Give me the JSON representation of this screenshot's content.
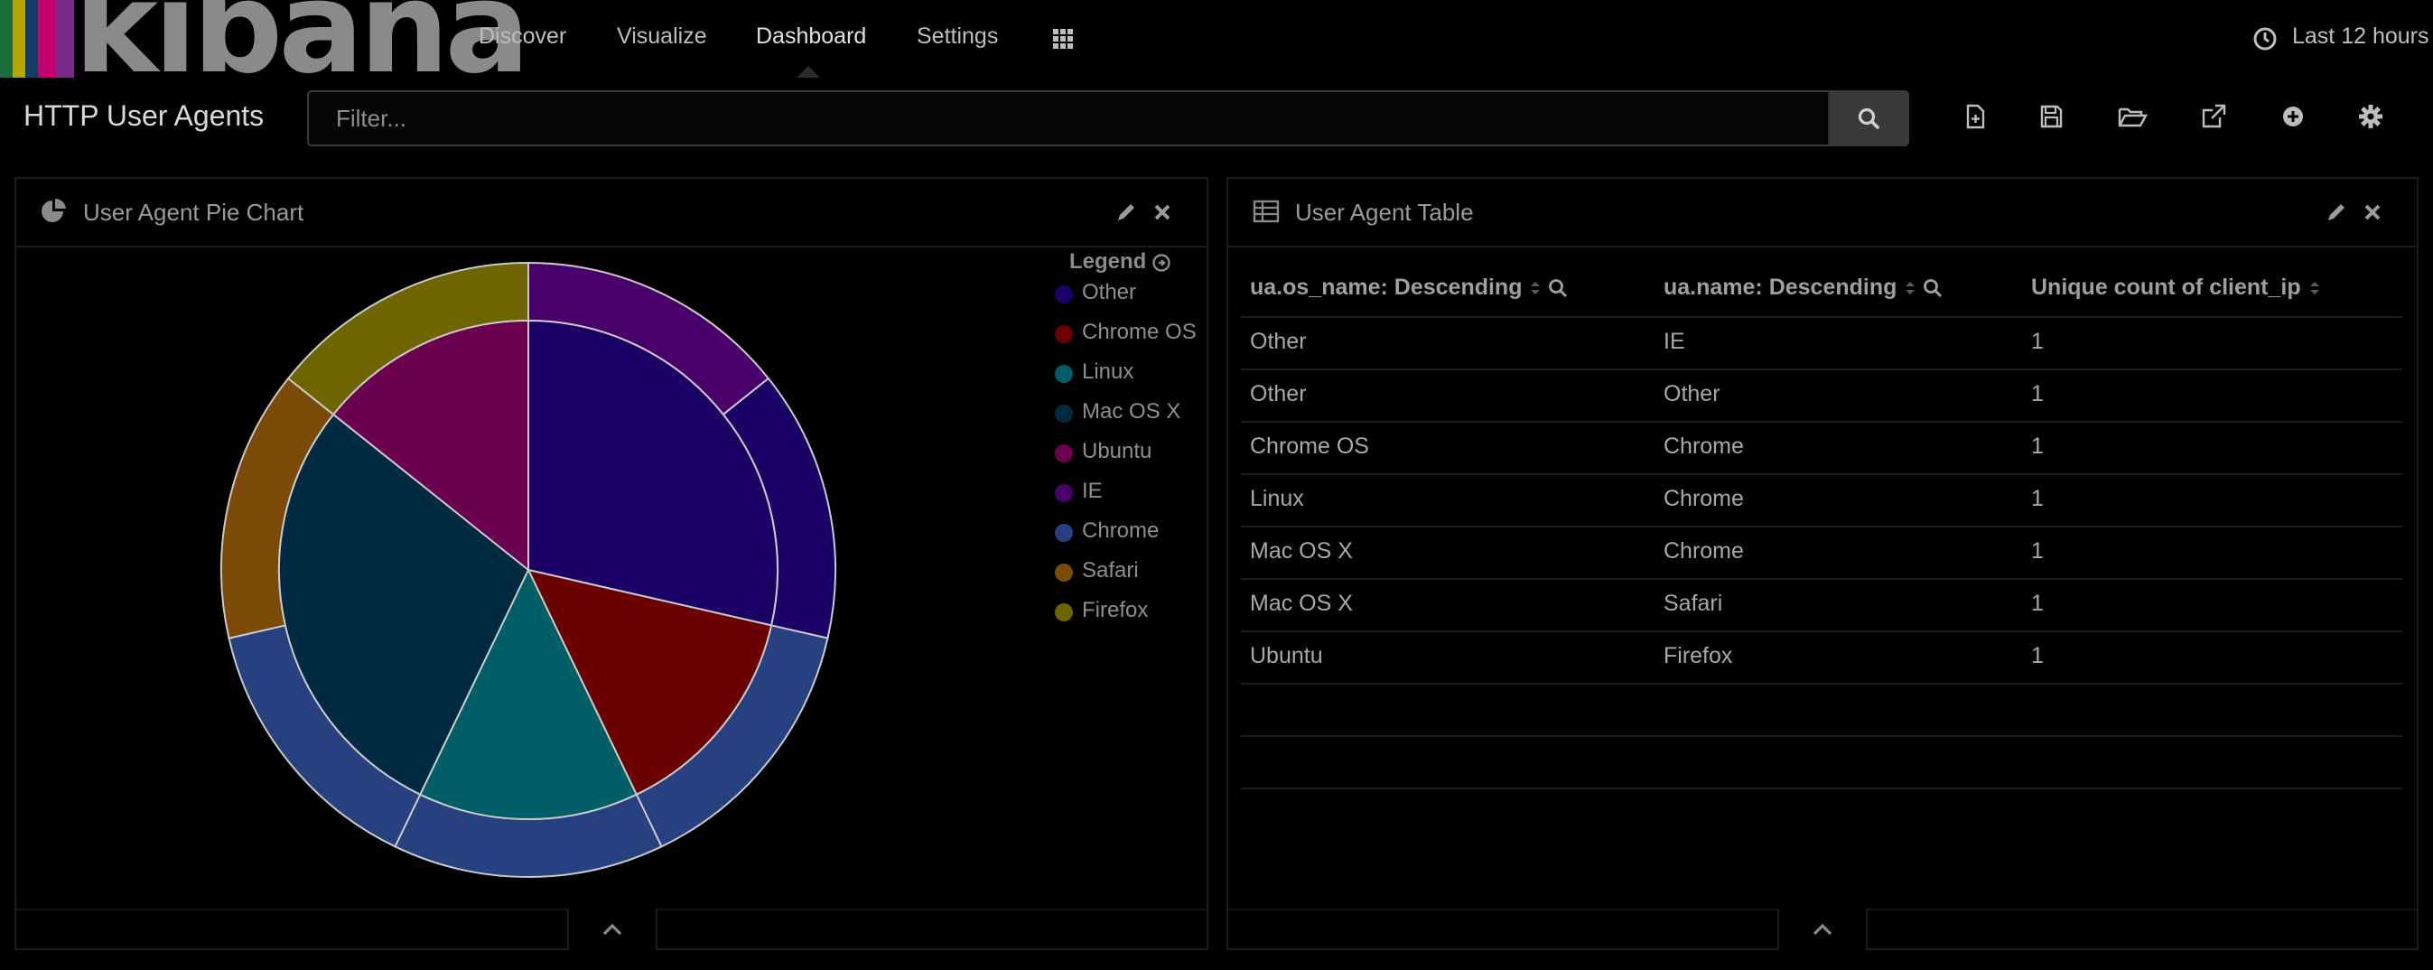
{
  "nav": {
    "logo_text": "kibana",
    "links": [
      "Discover",
      "Visualize",
      "Dashboard",
      "Settings"
    ],
    "active_link": "Dashboard",
    "time_label": "Last 12 hours"
  },
  "dashboard": {
    "title": "HTTP User Agents",
    "filter_placeholder": "Filter...",
    "toolbar_icons": [
      "new-dashboard-icon",
      "save-icon",
      "open-folder-icon",
      "share-icon",
      "add-visualization-icon",
      "settings-gear-icon"
    ]
  },
  "pie_panel": {
    "title": "User Agent Pie Chart",
    "legend_title": "Legend",
    "legend": [
      {
        "label": "Other",
        "color": "#1b0066"
      },
      {
        "label": "Chrome OS",
        "color": "#6b0000"
      },
      {
        "label": "Linux",
        "color": "#005f66"
      },
      {
        "label": "Mac OS X",
        "color": "#002a42"
      },
      {
        "label": "Ubuntu",
        "color": "#6b0050"
      },
      {
        "label": "IE",
        "color": "#4a006b"
      },
      {
        "label": "Chrome",
        "color": "#27407f"
      },
      {
        "label": "Safari",
        "color": "#7a4a06"
      },
      {
        "label": "Firefox",
        "color": "#6e6400"
      }
    ]
  },
  "chart_data": {
    "type": "pie",
    "title": "",
    "inner_ring": [
      {
        "label": "Other",
        "value": 2,
        "color": "#1b0066"
      },
      {
        "label": "Chrome OS",
        "value": 1,
        "color": "#6b0000"
      },
      {
        "label": "Linux",
        "value": 1,
        "color": "#005f66"
      },
      {
        "label": "Mac OS X",
        "value": 2,
        "color": "#002a42"
      },
      {
        "label": "Ubuntu",
        "value": 1,
        "color": "#6b0050"
      }
    ],
    "outer_ring": [
      {
        "label": "IE",
        "parent": "Other",
        "value": 1,
        "color": "#4a006b"
      },
      {
        "label": "Other",
        "parent": "Other",
        "value": 1,
        "color": "#1b0066"
      },
      {
        "label": "Chrome",
        "parent": "Chrome OS",
        "value": 1,
        "color": "#27407f"
      },
      {
        "label": "Chrome",
        "parent": "Linux",
        "value": 1,
        "color": "#27407f"
      },
      {
        "label": "Chrome",
        "parent": "Mac OS X",
        "value": 1,
        "color": "#27407f"
      },
      {
        "label": "Safari",
        "parent": "Mac OS X",
        "value": 1,
        "color": "#7a4a06"
      },
      {
        "label": "Firefox",
        "parent": "Ubuntu",
        "value": 1,
        "color": "#6e6400"
      }
    ]
  },
  "table_panel": {
    "title": "User Agent Table",
    "columns": [
      "ua.os_name: Descending",
      "ua.name: Descending",
      "Unique count of client_ip"
    ],
    "rows": [
      [
        "Other",
        "IE",
        "1"
      ],
      [
        "Other",
        "Other",
        "1"
      ],
      [
        "Chrome OS",
        "Chrome",
        "1"
      ],
      [
        "Linux",
        "Chrome",
        "1"
      ],
      [
        "Mac OS X",
        "Chrome",
        "1"
      ],
      [
        "Mac OS X",
        "Safari",
        "1"
      ],
      [
        "Ubuntu",
        "Firefox",
        "1"
      ]
    ]
  }
}
